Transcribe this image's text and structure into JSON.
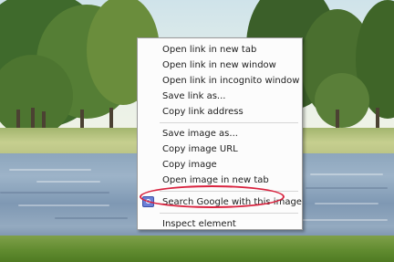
{
  "context_menu": {
    "items_group_link": [
      "Open link in new tab",
      "Open link in new window",
      "Open link in incognito window",
      "Save link as...",
      "Copy link address"
    ],
    "items_group_image": [
      "Save image as...",
      "Copy image URL",
      "Copy image",
      "Open image in new tab"
    ],
    "search_item": "Search Google with this image",
    "inspect_item": "Inspect element"
  },
  "colors": {
    "highlight_ring": "#d9233f",
    "search_icon": "#6b7fd6"
  },
  "icons": {
    "search_item_icon": "search-by-image-icon"
  }
}
